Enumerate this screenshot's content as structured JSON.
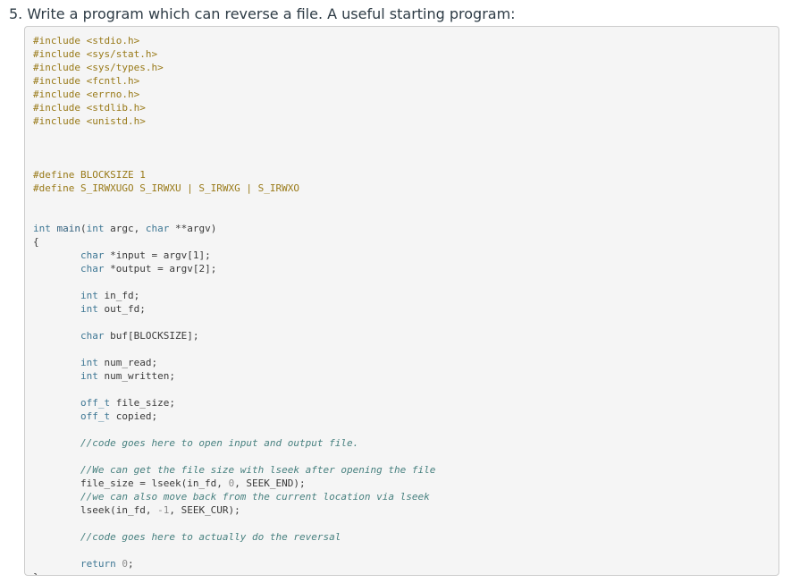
{
  "question": {
    "title": "5. Write a program which can reverse a file. A useful starting program:"
  },
  "code": {
    "inc1": "#include <stdio.h>",
    "inc2": "#include <sys/stat.h>",
    "inc3": "#include <sys/types.h>",
    "inc4": "#include <fcntl.h>",
    "inc5": "#include <errno.h>",
    "inc6": "#include <stdlib.h>",
    "inc7": "#include <unistd.h>",
    "def1": "#define BLOCKSIZE 1",
    "def2": "#define S_IRWXUGO S_IRWXU | S_IRWXG | S_IRWXO",
    "main_int": "int",
    "main_fn": "main",
    "main_args_a": "(",
    "main_args_int": "int",
    "main_args_b": " argc, ",
    "main_args_char": "char",
    "main_args_c": " **argv)",
    "brace_open": "{",
    "char_kw": "char",
    "input_decl": " *input = argv[1];",
    "output_decl": " *output = argv[2];",
    "int_kw": "int",
    "in_fd": " in_fd;",
    "out_fd": " out_fd;",
    "buf_decl": " buf[BLOCKSIZE];",
    "num_read": " num_read;",
    "num_written": " num_written;",
    "off_t_kw": "off_t",
    "file_size_decl": " file_size;",
    "copied_decl": " copied;",
    "comment1": "//code goes here to open input and output file.",
    "comment2": "//We can get the file size with lseek after opening the file",
    "lseek1_a": "file_size = lseek(in_fd, ",
    "zero": "0",
    "lseek1_b": ", SEEK_END);",
    "comment3": "//we can also move back from the current location via lseek",
    "lseek2_a": "lseek(in_fd, ",
    "minus_one": "-1",
    "lseek2_b": ", SEEK_CUR);",
    "comment4": "//code goes here to actually do the reversal",
    "return_kw": "return",
    "return_val": "0",
    "semicolon": ";",
    "brace_close": "}"
  }
}
